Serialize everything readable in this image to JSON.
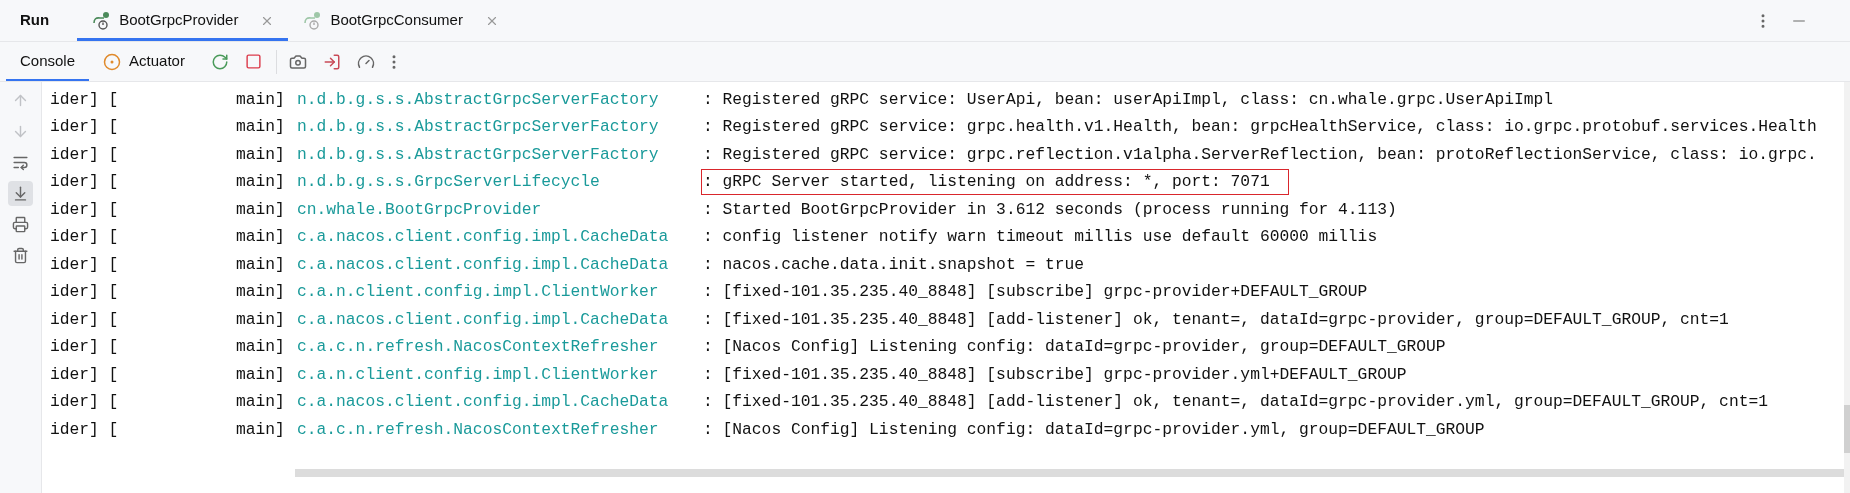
{
  "panel": {
    "title": "Run"
  },
  "run_tabs": [
    {
      "label": "BootGrpcProvider",
      "selected": true
    },
    {
      "label": "BootGrpcConsumer",
      "selected": false
    }
  ],
  "console_tabs": [
    {
      "label": "Console",
      "selected": true,
      "kind": "console"
    },
    {
      "label": "Actuator",
      "selected": false,
      "kind": "actuator"
    }
  ],
  "log_lines": [
    {
      "prefix": "ider] [",
      "thread": "main]",
      "logger": "n.d.b.g.s.s.AbstractGrpcServerFactory",
      "message": ": Registered gRPC service: UserApi, bean: userApiImpl, class: cn.whale.grpc.UserApiImpl",
      "highlighted": false
    },
    {
      "prefix": "ider] [",
      "thread": "main]",
      "logger": "n.d.b.g.s.s.AbstractGrpcServerFactory",
      "message": ": Registered gRPC service: grpc.health.v1.Health, bean: grpcHealthService, class: io.grpc.protobuf.services.Health",
      "highlighted": false
    },
    {
      "prefix": "ider] [",
      "thread": "main]",
      "logger": "n.d.b.g.s.s.AbstractGrpcServerFactory",
      "message": ": Registered gRPC service: grpc.reflection.v1alpha.ServerReflection, bean: protoReflectionService, class: io.grpc.",
      "highlighted": false
    },
    {
      "prefix": "ider] [",
      "thread": "main]",
      "logger": "n.d.b.g.s.s.GrpcServerLifecycle",
      "message": ": gRPC Server started, listening on address: *, port: 7071",
      "highlighted": true
    },
    {
      "prefix": "ider] [",
      "thread": "main]",
      "logger": "cn.whale.BootGrpcProvider",
      "message": ": Started BootGrpcProvider in 3.612 seconds (process running for 4.113)",
      "highlighted": false
    },
    {
      "prefix": "ider] [",
      "thread": "main]",
      "logger": "c.a.nacos.client.config.impl.CacheData",
      "message": ": config listener notify warn timeout millis use default 60000 millis",
      "highlighted": false
    },
    {
      "prefix": "ider] [",
      "thread": "main]",
      "logger": "c.a.nacos.client.config.impl.CacheData",
      "message": ": nacos.cache.data.init.snapshot = true",
      "highlighted": false
    },
    {
      "prefix": "ider] [",
      "thread": "main]",
      "logger": "c.a.n.client.config.impl.ClientWorker",
      "message": ": [fixed-101.35.235.40_8848] [subscribe] grpc-provider+DEFAULT_GROUP",
      "highlighted": false
    },
    {
      "prefix": "ider] [",
      "thread": "main]",
      "logger": "c.a.nacos.client.config.impl.CacheData",
      "message": ": [fixed-101.35.235.40_8848] [add-listener] ok, tenant=, dataId=grpc-provider, group=DEFAULT_GROUP, cnt=1",
      "highlighted": false
    },
    {
      "prefix": "ider] [",
      "thread": "main]",
      "logger": "c.a.c.n.refresh.NacosContextRefresher",
      "message": ": [Nacos Config] Listening config: dataId=grpc-provider, group=DEFAULT_GROUP",
      "highlighted": false
    },
    {
      "prefix": "ider] [",
      "thread": "main]",
      "logger": "c.a.n.client.config.impl.ClientWorker",
      "message": ": [fixed-101.35.235.40_8848] [subscribe] grpc-provider.yml+DEFAULT_GROUP",
      "highlighted": false
    },
    {
      "prefix": "ider] [",
      "thread": "main]",
      "logger": "c.a.nacos.client.config.impl.CacheData",
      "message": ": [fixed-101.35.235.40_8848] [add-listener] ok, tenant=, dataId=grpc-provider.yml, group=DEFAULT_GROUP, cnt=1",
      "highlighted": false
    },
    {
      "prefix": "ider] [",
      "thread": "main]",
      "logger": "c.a.c.n.refresh.NacosContextRefresher",
      "message": ": [Nacos Config] Listening config: dataId=grpc-provider.yml, group=DEFAULT_GROUP",
      "highlighted": false
    }
  ]
}
